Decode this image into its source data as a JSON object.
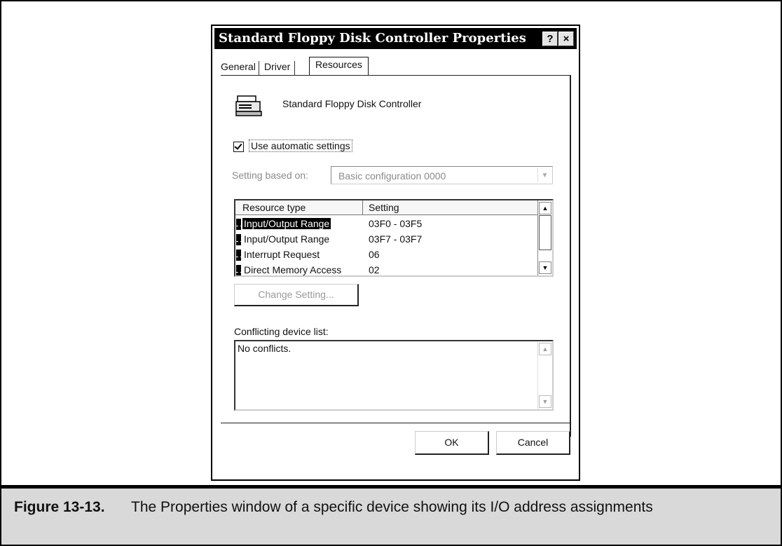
{
  "dialog": {
    "title": "Standard Floppy Disk Controller Properties",
    "help_glyph": "?",
    "close_glyph": "×"
  },
  "tabs": [
    {
      "label": "General"
    },
    {
      "label": "Driver"
    },
    {
      "label": "Resources",
      "active": true
    }
  ],
  "device": {
    "icon": "floppy-controller-icon",
    "name": "Standard Floppy Disk Controller"
  },
  "auto_settings": {
    "label": "Use automatic settings",
    "checked": true
  },
  "setting_based_on": {
    "label": "Setting based on:",
    "value": "Basic configuration 0000",
    "disabled": true
  },
  "resources": {
    "columns": [
      "Resource type",
      "Setting"
    ],
    "rows": [
      {
        "type": "Input/Output Range",
        "setting": "03F0 - 03F5",
        "selected": true
      },
      {
        "type": "Input/Output Range",
        "setting": "03F7 - 03F7"
      },
      {
        "type": "Interrupt Request",
        "setting": "06"
      },
      {
        "type": "Direct Memory Access",
        "setting": "02"
      }
    ]
  },
  "change_setting": {
    "label": "Change Setting...",
    "disabled": true
  },
  "conflicts": {
    "label": "Conflicting device list:",
    "text": "No conflicts."
  },
  "buttons": {
    "ok": "OK",
    "cancel": "Cancel"
  },
  "caption": {
    "label": "Figure 13-13.",
    "text": "The Properties window of a specific device showing its I/O address assignments"
  }
}
